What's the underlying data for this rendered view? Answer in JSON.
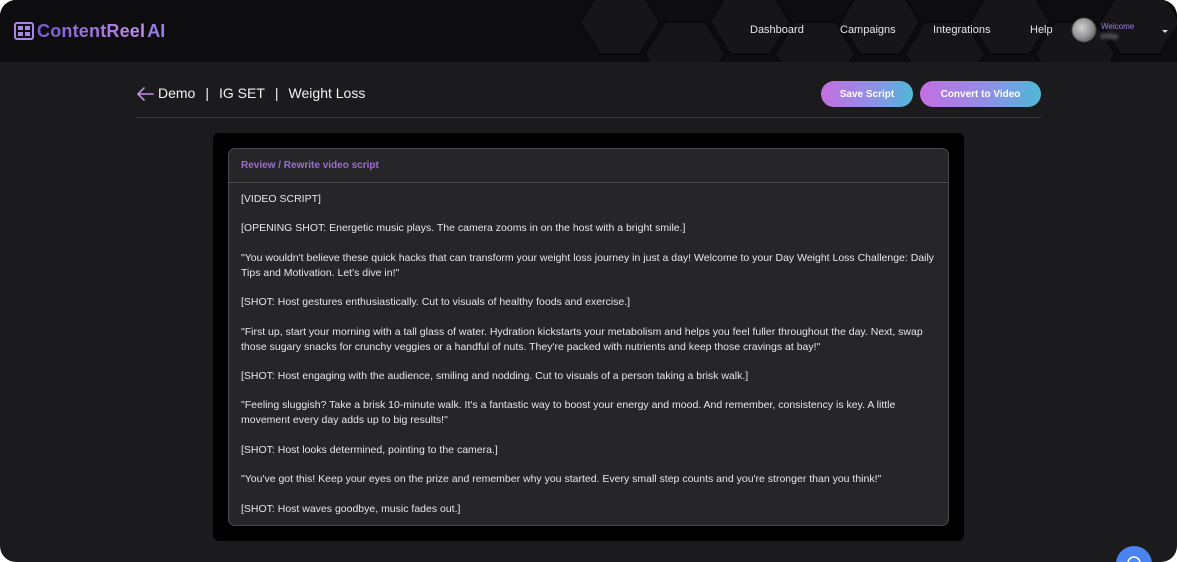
{
  "brand": {
    "name": "ContentReel",
    "suffix": "AI"
  },
  "nav": {
    "links": [
      "Dashboard",
      "Campaigns",
      "Integrations",
      "Help"
    ],
    "welcome": "Welcome",
    "username": "Mike"
  },
  "header": {
    "crumbs": [
      "Demo",
      "IG SET",
      "Weight Loss"
    ],
    "save_label": "Save Script",
    "convert_label": "Convert to Video"
  },
  "panel": {
    "title": "Review / Rewrite video script",
    "lines": [
      "[VIDEO SCRIPT]",
      "[OPENING SHOT: Energetic music plays. The camera zooms in on the host with a bright smile.]",
      "\"You wouldn't believe these quick hacks that can transform your weight loss journey in just a day! Welcome to your Day Weight Loss Challenge: Daily Tips and Motivation. Let's dive in!\"",
      "[SHOT: Host gestures enthusiastically. Cut to visuals of healthy foods and exercise.]",
      "\"First up, start your morning with a tall glass of water. Hydration kickstarts your metabolism and helps you feel fuller throughout the day. Next, swap those sugary snacks for crunchy veggies or a handful of nuts. They're packed with nutrients and keep those cravings at bay!\"",
      "[SHOT: Host engaging with the audience, smiling and nodding. Cut to visuals of a person taking a brisk walk.]",
      "\"Feeling sluggish? Take a brisk 10-minute walk. It's a fantastic way to boost your energy and mood. And remember, consistency is key. A little movement every day adds up to big results!\"",
      "[SHOT: Host looks determined, pointing to the camera.]",
      "\"You've got this! Keep your eyes on the prize and remember why you started. Every small step counts and you're stronger than you think!\"",
      "[SHOT: Host waves goodbye, music fades out.]"
    ]
  },
  "colors": {
    "accent_purple": "#9b6fd2",
    "button_gradient_start": "#c46fe0",
    "button_gradient_end": "#4fb8d8",
    "chat_bubble": "#4b84f0"
  }
}
